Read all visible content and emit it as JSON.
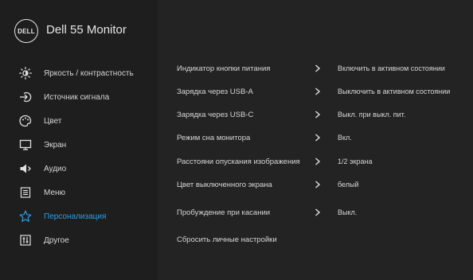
{
  "header": {
    "logo_text": "DELL",
    "title": "Dell 55 Monitor"
  },
  "sidebar": {
    "items": [
      {
        "label": "Яркость / контрастность",
        "icon": "brightness-icon"
      },
      {
        "label": "Источник сигнала",
        "icon": "input-source-icon"
      },
      {
        "label": "Цвет",
        "icon": "color-icon"
      },
      {
        "label": "Экран",
        "icon": "display-icon"
      },
      {
        "label": "Аудио",
        "icon": "audio-icon"
      },
      {
        "label": "Меню",
        "icon": "menu-icon"
      },
      {
        "label": "Персонализация",
        "icon": "star-icon",
        "active": true
      },
      {
        "label": "Другое",
        "icon": "others-icon"
      }
    ]
  },
  "settings": {
    "rows": [
      {
        "label": "Индикатор кнопки питания",
        "value": "Включить в активном состоянии"
      },
      {
        "label": "Зарядка через USB-A",
        "value": "Выключить в активном состоянии"
      },
      {
        "label": "Зарядка через USB-C",
        "value": "Выкл. при выкл. пит."
      },
      {
        "label": "Режим сна монитора",
        "value": "Вкл."
      },
      {
        "label": "Расстояни опускания изображения",
        "value": "1/2 экрана"
      },
      {
        "label": "Цвет выключенного экрана",
        "value": "белый"
      },
      {
        "label": "Пробуждение при касании",
        "value": "Выкл."
      },
      {
        "label": "Сбросить личные настройки",
        "value": ""
      }
    ]
  },
  "colors": {
    "accent": "#2aa0e8",
    "text": "#d6d6d6",
    "panel_left": "#1e1e1e",
    "panel_right": "#232323"
  }
}
